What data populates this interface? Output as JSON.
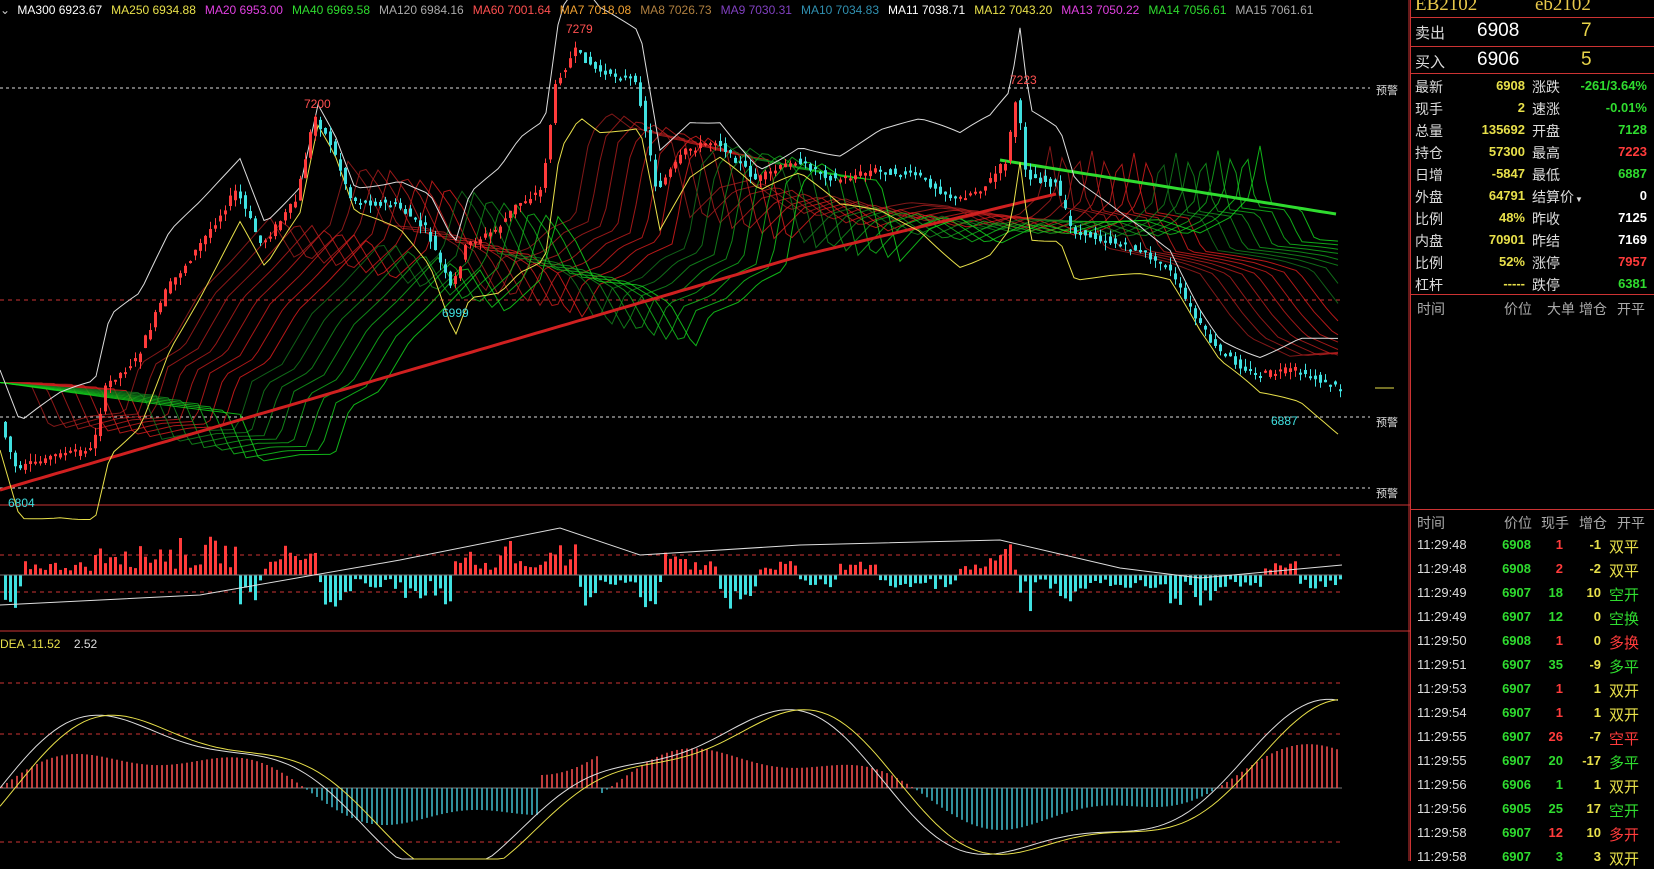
{
  "ma_legend": [
    {
      "text": "MA300 6923.67",
      "color": "#ffffff"
    },
    {
      "text": "MA250 6934.88",
      "color": "#e8e04a"
    },
    {
      "text": "MA20 6953.00",
      "color": "#e040e0"
    },
    {
      "text": "MA40 6969.58",
      "color": "#2fdc2f"
    },
    {
      "text": "MA120 6984.16",
      "color": "#aaaaaa"
    },
    {
      "text": "MA60 7001.64",
      "color": "#ff5050"
    },
    {
      "text": "MA7 7018.08",
      "color": "#f0a030"
    },
    {
      "text": "MA8 7026.73",
      "color": "#b08040"
    },
    {
      "text": "MA9 7030.31",
      "color": "#8040c0"
    },
    {
      "text": "MA10 7034.83",
      "color": "#3090b0"
    },
    {
      "text": "MA11 7038.71",
      "color": "#ffffff"
    },
    {
      "text": "MA12 7043.20",
      "color": "#e8e04a"
    },
    {
      "text": "MA13 7050.22",
      "color": "#e040e0"
    },
    {
      "text": "MA14 7056.61",
      "color": "#2fdc2f"
    },
    {
      "text": "MA15 7061.61",
      "color": "#aaaaaa"
    }
  ],
  "price_labels": {
    "p7279": "7279",
    "p7200": "7200",
    "p7223": "7223",
    "p6999": "6999",
    "p6804": "6804",
    "p6887": "6887"
  },
  "warn_label": "预警",
  "macd_legend": {
    "dea": "DEA -11.52",
    "value": "2.52"
  },
  "panel": {
    "title_left": "EB2102",
    "title_right": "eb2102",
    "ask": {
      "label": "卖出",
      "price": "6908",
      "volume": "7"
    },
    "bid": {
      "label": "买入",
      "price": "6906",
      "volume": "5"
    },
    "quotes": [
      {
        "l1": "最新",
        "v1": "6908",
        "c1": "yellow",
        "l2": "涨跌",
        "v2": "-261/3.64%",
        "c2": "green"
      },
      {
        "l1": "现手",
        "v1": "2",
        "c1": "yellow",
        "l2": "速涨",
        "v2": "-0.01%",
        "c2": "green"
      },
      {
        "l1": "总量",
        "v1": "135692",
        "c1": "yellow",
        "l2": "开盘",
        "v2": "7128",
        "c2": "green"
      },
      {
        "l1": "持仓",
        "v1": "57300",
        "c1": "yellow",
        "l2": "最高",
        "v2": "7223",
        "c2": "red"
      },
      {
        "l1": "日增",
        "v1": "-5847",
        "c1": "yellow",
        "l2": "最低",
        "v2": "6887",
        "c2": "green"
      },
      {
        "l1": "外盘",
        "v1": "64791",
        "c1": "yellow",
        "l2": "结算价",
        "v2": "0",
        "c2": "white"
      },
      {
        "l1": "比例",
        "v1": "48%",
        "c1": "yellow",
        "l2": "昨收",
        "v2": "7125",
        "c2": "white"
      },
      {
        "l1": "内盘",
        "v1": "70901",
        "c1": "yellow",
        "l2": "昨结",
        "v2": "7169",
        "c2": "white"
      },
      {
        "l1": "比例",
        "v1": "52%",
        "c1": "yellow",
        "l2": "涨停",
        "v2": "7957",
        "c2": "red"
      },
      {
        "l1": "杠杆",
        "v1": "-----",
        "c1": "yellow",
        "l2": "跌停",
        "v2": "6381",
        "c2": "green"
      }
    ],
    "big_order_header": {
      "time": "时间",
      "price": "价位",
      "big": "大单",
      "inc": "增仓",
      "type": "开平"
    },
    "tick_header": {
      "time": "时间",
      "price": "价位",
      "vol": "现手",
      "inc": "增仓",
      "type": "开平"
    },
    "ticks": [
      {
        "time": "11:29:48",
        "price": "6908",
        "vol": "1",
        "inc": "-1",
        "type": "双平",
        "pc": "green",
        "vc": "red",
        "ic": "yellow",
        "tc": "yellow"
      },
      {
        "time": "11:29:48",
        "price": "6908",
        "vol": "2",
        "inc": "-2",
        "type": "双平",
        "pc": "green",
        "vc": "red",
        "ic": "yellow",
        "tc": "yellow"
      },
      {
        "time": "11:29:49",
        "price": "6907",
        "vol": "18",
        "inc": "10",
        "type": "空开",
        "pc": "green",
        "vc": "green",
        "ic": "yellow",
        "tc": "green"
      },
      {
        "time": "11:29:49",
        "price": "6907",
        "vol": "12",
        "inc": "0",
        "type": "空换",
        "pc": "green",
        "vc": "green",
        "ic": "yellow",
        "tc": "green"
      },
      {
        "time": "11:29:50",
        "price": "6908",
        "vol": "1",
        "inc": "0",
        "type": "多换",
        "pc": "green",
        "vc": "red",
        "ic": "yellow",
        "tc": "red"
      },
      {
        "time": "11:29:51",
        "price": "6907",
        "vol": "35",
        "inc": "-9",
        "type": "多平",
        "pc": "green",
        "vc": "green",
        "ic": "yellow",
        "tc": "green"
      },
      {
        "time": "11:29:53",
        "price": "6907",
        "vol": "1",
        "inc": "1",
        "type": "双开",
        "pc": "green",
        "vc": "red",
        "ic": "yellow",
        "tc": "yellow"
      },
      {
        "time": "11:29:54",
        "price": "6907",
        "vol": "1",
        "inc": "1",
        "type": "双开",
        "pc": "green",
        "vc": "red",
        "ic": "yellow",
        "tc": "yellow"
      },
      {
        "time": "11:29:55",
        "price": "6907",
        "vol": "26",
        "inc": "-7",
        "type": "空平",
        "pc": "green",
        "vc": "red",
        "ic": "yellow",
        "tc": "red"
      },
      {
        "time": "11:29:55",
        "price": "6907",
        "vol": "20",
        "inc": "-17",
        "type": "多平",
        "pc": "green",
        "vc": "green",
        "ic": "yellow",
        "tc": "green"
      },
      {
        "time": "11:29:56",
        "price": "6906",
        "vol": "1",
        "inc": "1",
        "type": "双开",
        "pc": "green",
        "vc": "green",
        "ic": "yellow",
        "tc": "yellow"
      },
      {
        "time": "11:29:56",
        "price": "6905",
        "vol": "25",
        "inc": "17",
        "type": "空开",
        "pc": "green",
        "vc": "green",
        "ic": "yellow",
        "tc": "green"
      },
      {
        "time": "11:29:58",
        "price": "6907",
        "vol": "12",
        "inc": "10",
        "type": "多开",
        "pc": "green",
        "vc": "red",
        "ic": "yellow",
        "tc": "red"
      },
      {
        "time": "11:29:58",
        "price": "6907",
        "vol": "3",
        "inc": "3",
        "type": "双开",
        "pc": "green",
        "vc": "green",
        "ic": "yellow",
        "tc": "yellow"
      }
    ]
  },
  "colors": {
    "up": "#ff3b3b",
    "down": "#40e0e0",
    "grid": "#c33",
    "bg": "#000000"
  }
}
